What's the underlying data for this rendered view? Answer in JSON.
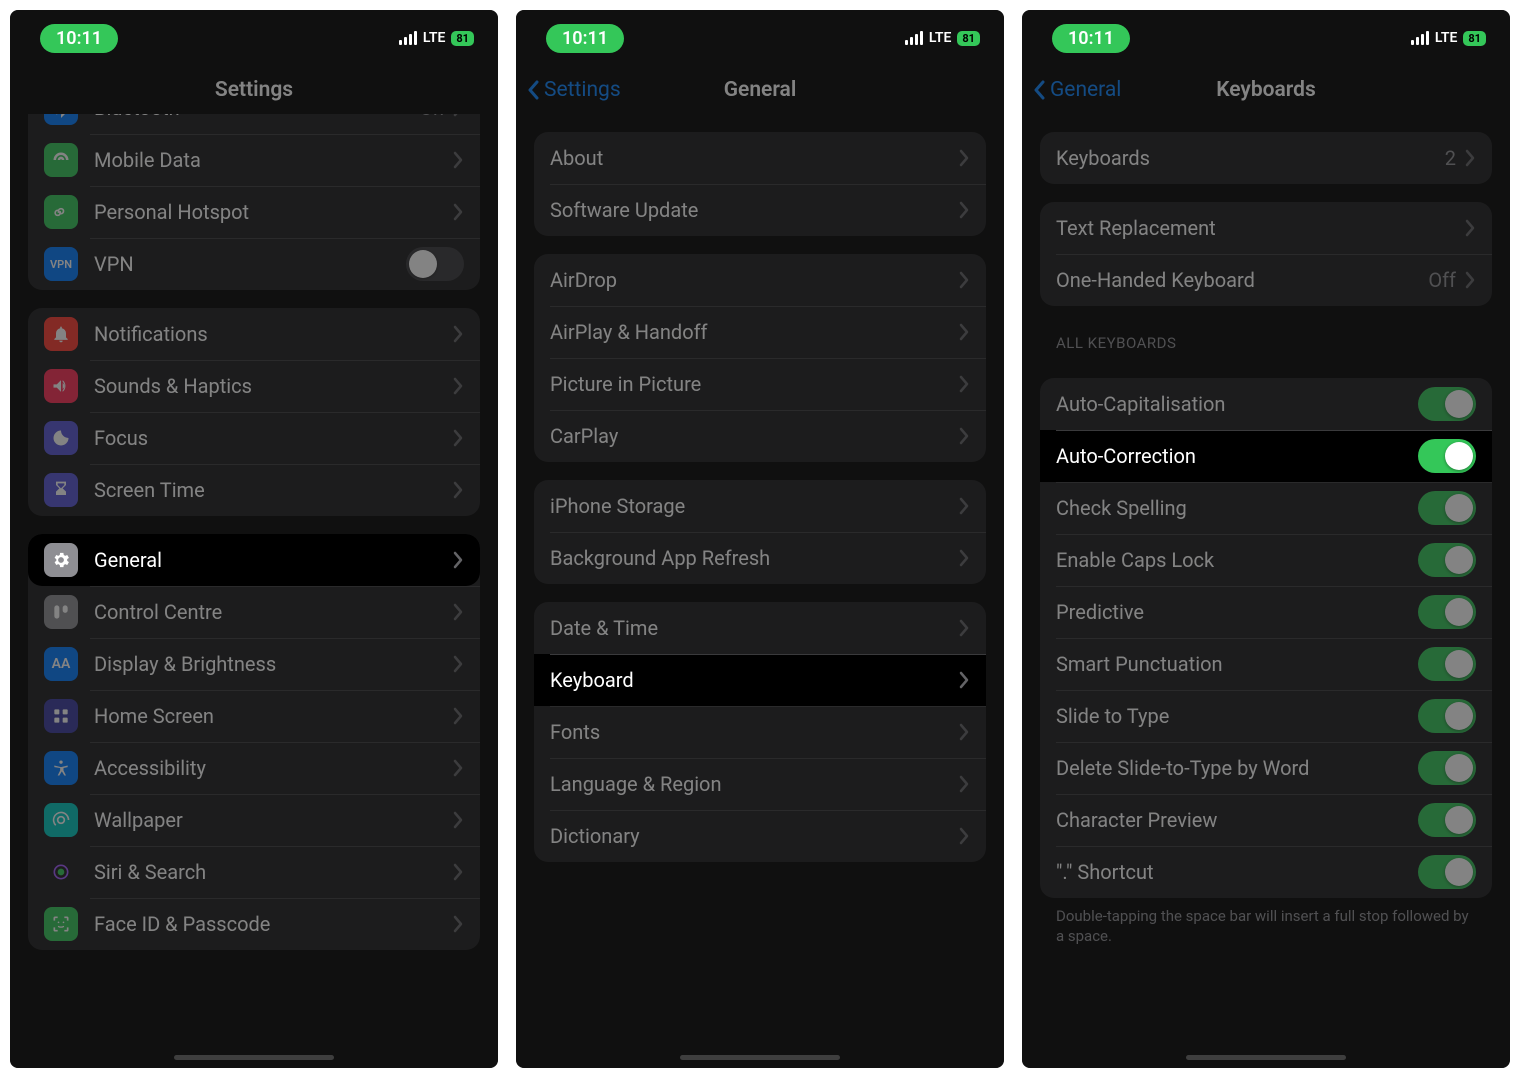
{
  "status": {
    "time": "10:11",
    "net": "LTE",
    "battery": "81"
  },
  "screen1": {
    "title": "Settings",
    "rows_top": [
      {
        "id": "bluetooth",
        "label": "Bluetooth",
        "detail": "On",
        "iconColor": "#007aff"
      },
      {
        "id": "mobile-data",
        "label": "Mobile Data",
        "iconColor": "#34c759"
      },
      {
        "id": "personal-hotspot",
        "label": "Personal Hotspot",
        "iconColor": "#34c759"
      },
      {
        "id": "vpn",
        "label": "VPN",
        "iconColor": "#007aff",
        "type": "toggle",
        "on": false,
        "iconText": "VPN"
      }
    ],
    "rows_notify": [
      {
        "id": "notifications",
        "label": "Notifications",
        "iconColor": "#ff3b30"
      },
      {
        "id": "sounds",
        "label": "Sounds & Haptics",
        "iconColor": "#ff2d55"
      },
      {
        "id": "focus",
        "label": "Focus",
        "iconColor": "#5856d6"
      },
      {
        "id": "screen-time",
        "label": "Screen Time",
        "iconColor": "#5856d6"
      }
    ],
    "rows_general": [
      {
        "id": "general",
        "label": "General",
        "iconColor": "#8e8e93",
        "highlight": true
      },
      {
        "id": "control-centre",
        "label": "Control Centre",
        "iconColor": "#8e8e93"
      },
      {
        "id": "display",
        "label": "Display & Brightness",
        "iconColor": "#007aff",
        "iconText": "AA"
      },
      {
        "id": "home-screen",
        "label": "Home Screen",
        "iconColor": "#3a3a9f"
      },
      {
        "id": "accessibility",
        "label": "Accessibility",
        "iconColor": "#007aff"
      },
      {
        "id": "wallpaper",
        "label": "Wallpaper",
        "iconColor": "#00c7be"
      },
      {
        "id": "siri",
        "label": "Siri & Search",
        "iconColor": "#1c1c1e"
      },
      {
        "id": "faceid",
        "label": "Face ID & Passcode",
        "iconColor": "#34c759"
      }
    ]
  },
  "screen2": {
    "back": "Settings",
    "title": "General",
    "g1": [
      {
        "id": "about",
        "label": "About"
      },
      {
        "id": "software-update",
        "label": "Software Update"
      }
    ],
    "g2": [
      {
        "id": "airdrop",
        "label": "AirDrop"
      },
      {
        "id": "airplay",
        "label": "AirPlay & Handoff"
      },
      {
        "id": "pip",
        "label": "Picture in Picture"
      },
      {
        "id": "carplay",
        "label": "CarPlay"
      }
    ],
    "g3": [
      {
        "id": "storage",
        "label": "iPhone Storage"
      },
      {
        "id": "bg-refresh",
        "label": "Background App Refresh"
      }
    ],
    "g4": [
      {
        "id": "date-time",
        "label": "Date & Time"
      },
      {
        "id": "keyboard",
        "label": "Keyboard",
        "highlight": true
      },
      {
        "id": "fonts",
        "label": "Fonts"
      },
      {
        "id": "language",
        "label": "Language & Region"
      },
      {
        "id": "dictionary",
        "label": "Dictionary"
      }
    ]
  },
  "screen3": {
    "back": "General",
    "title": "Keyboards",
    "g1": [
      {
        "id": "keyboards",
        "label": "Keyboards",
        "detail": "2"
      }
    ],
    "g2": [
      {
        "id": "text-replacement",
        "label": "Text Replacement"
      },
      {
        "id": "one-handed",
        "label": "One-Handed Keyboard",
        "detail": "Off"
      }
    ],
    "header_all": "ALL KEYBOARDS",
    "g3": [
      {
        "id": "auto-cap",
        "label": "Auto-Capitalisation",
        "on": true
      },
      {
        "id": "auto-correct",
        "label": "Auto-Correction",
        "on": true,
        "highlight": true
      },
      {
        "id": "check-spelling",
        "label": "Check Spelling",
        "on": true
      },
      {
        "id": "caps-lock",
        "label": "Enable Caps Lock",
        "on": true
      },
      {
        "id": "predictive",
        "label": "Predictive",
        "on": true
      },
      {
        "id": "smart-punct",
        "label": "Smart Punctuation",
        "on": true
      },
      {
        "id": "slide-type",
        "label": "Slide to Type",
        "on": true
      },
      {
        "id": "delete-slide",
        "label": "Delete Slide-to-Type by Word",
        "on": true
      },
      {
        "id": "char-preview",
        "label": "Character Preview",
        "on": true
      },
      {
        "id": "dot-shortcut",
        "label": "\".\" Shortcut",
        "on": true
      }
    ],
    "footer": "Double-tapping the space bar will insert a full stop followed by a space."
  }
}
